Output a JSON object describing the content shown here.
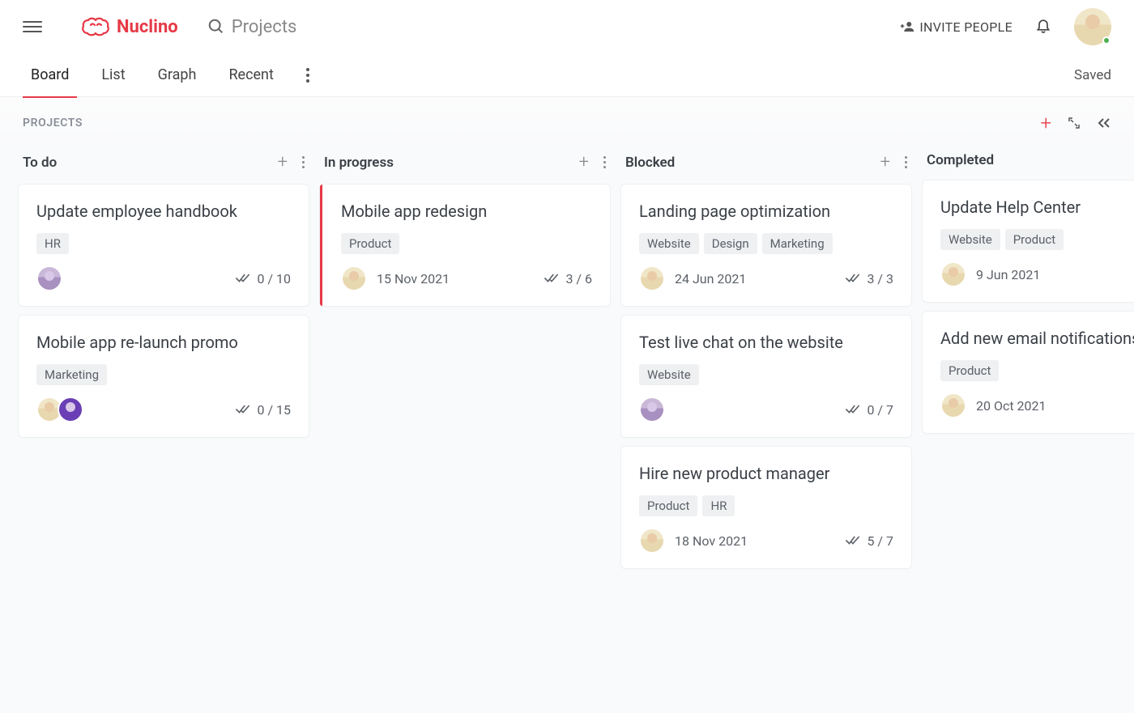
{
  "header": {
    "logo_text": "Nuclino",
    "search_placeholder": "Projects",
    "invite_label": "INVITE PEOPLE"
  },
  "tabs": {
    "items": [
      {
        "label": "Board",
        "active": true
      },
      {
        "label": "List",
        "active": false
      },
      {
        "label": "Graph",
        "active": false
      },
      {
        "label": "Recent",
        "active": false
      }
    ],
    "status": "Saved"
  },
  "board_header": {
    "title": "PROJECTS"
  },
  "columns": [
    {
      "title": "To do",
      "show_actions": true,
      "cards": [
        {
          "title": "Update employee handbook",
          "tags": [
            "HR"
          ],
          "avatars": [
            "b"
          ],
          "date": "",
          "progress": "0 / 10",
          "accent": false
        },
        {
          "title": "Mobile app re-launch promo",
          "tags": [
            "Marketing"
          ],
          "avatars": [
            "a",
            "c"
          ],
          "date": "",
          "progress": "0 / 15",
          "accent": false
        }
      ]
    },
    {
      "title": "In progress",
      "show_actions": true,
      "cards": [
        {
          "title": "Mobile app redesign",
          "tags": [
            "Product"
          ],
          "avatars": [
            "a"
          ],
          "date": "15 Nov 2021",
          "progress": "3 / 6",
          "accent": true
        }
      ]
    },
    {
      "title": "Blocked",
      "show_actions": true,
      "cards": [
        {
          "title": "Landing page optimization",
          "tags": [
            "Website",
            "Design",
            "Marketing"
          ],
          "avatars": [
            "a"
          ],
          "date": "24 Jun 2021",
          "progress": "3 / 3",
          "accent": false
        },
        {
          "title": "Test live chat on the website",
          "tags": [
            "Website"
          ],
          "avatars": [
            "b"
          ],
          "date": "",
          "progress": "0 / 7",
          "accent": false
        },
        {
          "title": "Hire new product manager",
          "tags": [
            "Product",
            "HR"
          ],
          "avatars": [
            "a"
          ],
          "date": "18 Nov 2021",
          "progress": "5 / 7",
          "accent": false
        }
      ]
    },
    {
      "title": "Completed",
      "show_actions": false,
      "cards": [
        {
          "title": "Update Help Center",
          "tags": [
            "Website",
            "Product"
          ],
          "avatars": [
            "a"
          ],
          "date": "9 Jun 2021",
          "progress": "",
          "accent": false
        },
        {
          "title": "Add new email notifications",
          "tags": [
            "Product"
          ],
          "avatars": [
            "a"
          ],
          "date": "20 Oct 2021",
          "progress": "",
          "accent": false
        }
      ]
    }
  ]
}
